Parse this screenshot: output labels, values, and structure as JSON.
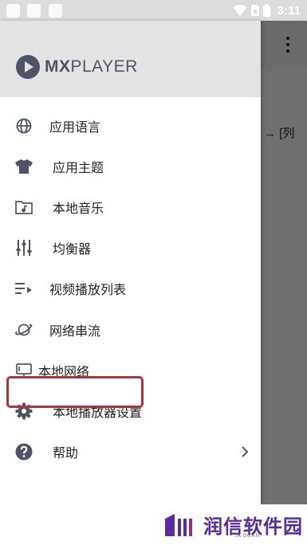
{
  "status_bar": {
    "time": "3:11"
  },
  "app": {
    "logo_bold": "MX",
    "logo_light": "PLAYER"
  },
  "background": {
    "text": "→ [列"
  },
  "menu": {
    "items": [
      {
        "label": "应用语言",
        "icon": "globe-icon"
      },
      {
        "label": "应用主题",
        "icon": "tshirt-icon"
      },
      {
        "label": "本地音乐",
        "icon": "music-folder-icon"
      },
      {
        "label": "均衡器",
        "icon": "equalizer-icon"
      },
      {
        "label": "视频播放列表",
        "icon": "playlist-icon"
      },
      {
        "label": "网络串流",
        "icon": "planet-icon"
      },
      {
        "label": "本地网络",
        "icon": "monitor-icon"
      },
      {
        "label": "本地播放器设置",
        "icon": "gear-icon"
      },
      {
        "label": "帮助",
        "icon": "help-icon"
      }
    ]
  },
  "watermark": {
    "text": "润信软件园",
    "slogan": "SLOGAN"
  },
  "colors": {
    "icon": "#4e5466",
    "header_bg": "#e3e3e3",
    "highlight": "#b5313a",
    "watermark": "#5a2aa0"
  }
}
